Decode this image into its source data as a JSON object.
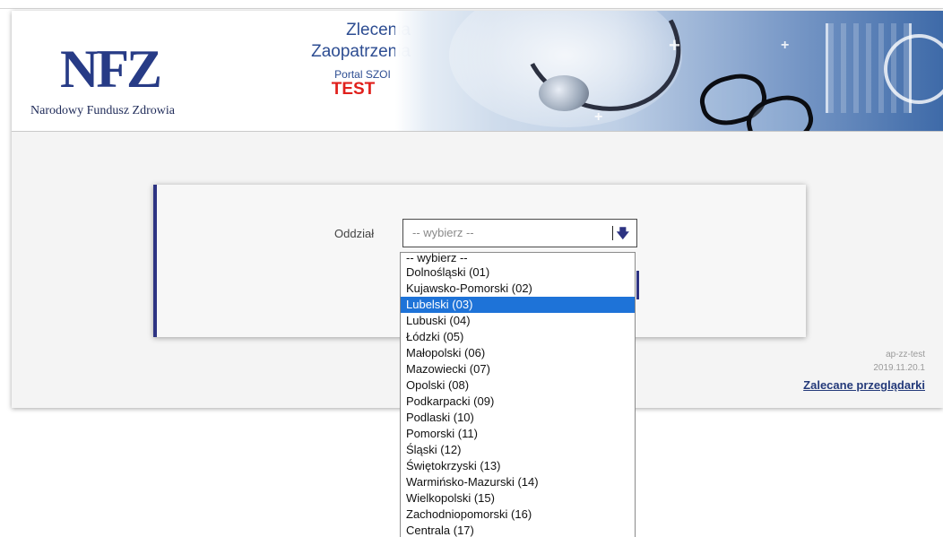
{
  "header": {
    "logo_mark": "NFZ",
    "logo_text": "Narodowy Fundusz Zdrowia",
    "title_line1": "Zlecenia",
    "title_line2": "Zaopatrzenia",
    "portal": "Portal SZOI",
    "env_badge": "TEST"
  },
  "form": {
    "label": "Oddział",
    "select_value": "-- wybierz --",
    "arrow_icon": "arrow-down-icon"
  },
  "dropdown": {
    "options": [
      "-- wybierz --",
      "Dolnośląski (01)",
      "Kujawsko-Pomorski (02)",
      "Lubelski (03)",
      "Lubuski (04)",
      "Łódzki (05)",
      "Małopolski (06)",
      "Mazowiecki (07)",
      "Opolski (08)",
      "Podkarpacki (09)",
      "Podlaski (10)",
      "Pomorski (11)",
      "Śląski (12)",
      "Świętokrzyski (13)",
      "Warmińsko-Mazurski (14)",
      "Wielkopolski (15)",
      "Zachodniopomorski (16)",
      "Centrala (17)"
    ],
    "highlighted": "Lubelski (03)"
  },
  "footer": {
    "env": "ap-zz-test",
    "version": "2019.11.20.1",
    "browsers_link": "Zalecane przeglądarki"
  },
  "colors": {
    "brand_blue": "#2d3382",
    "test_red": "#e0201c",
    "highlight": "#1e73d8"
  }
}
